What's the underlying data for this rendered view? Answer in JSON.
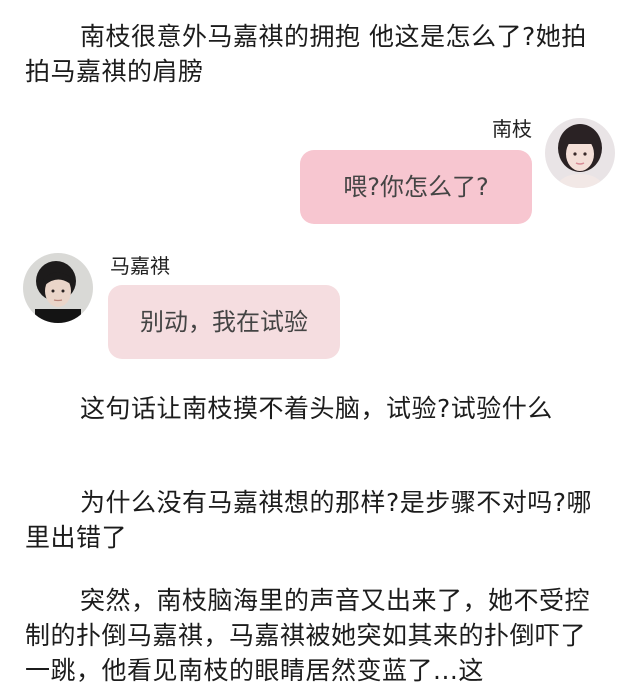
{
  "paragraphs": [
    "南枝很意外马嘉祺的拥抱 他这是怎么了?她拍拍马嘉祺的肩膀",
    "这句话让南枝摸不着头脑，试验?试验什么",
    "为什么没有马嘉祺想的那样?是步骤不对吗?哪里出错了",
    "突然，南枝脑海里的声音又出来了，她不受控制的扑倒马嘉祺，马嘉祺被她突如其来的扑倒吓了一跳，他看见南枝的眼睛居然变蓝了...这"
  ],
  "chat": {
    "right": {
      "name": "南枝",
      "message": "喂?你怎么了?",
      "bubble_color": "#f7c6d0",
      "avatar": "girl-avatar-icon"
    },
    "left": {
      "name": "马嘉祺",
      "message": "别动，我在试验",
      "bubble_color": "#f5dde0",
      "avatar": "boy-avatar-icon"
    }
  }
}
